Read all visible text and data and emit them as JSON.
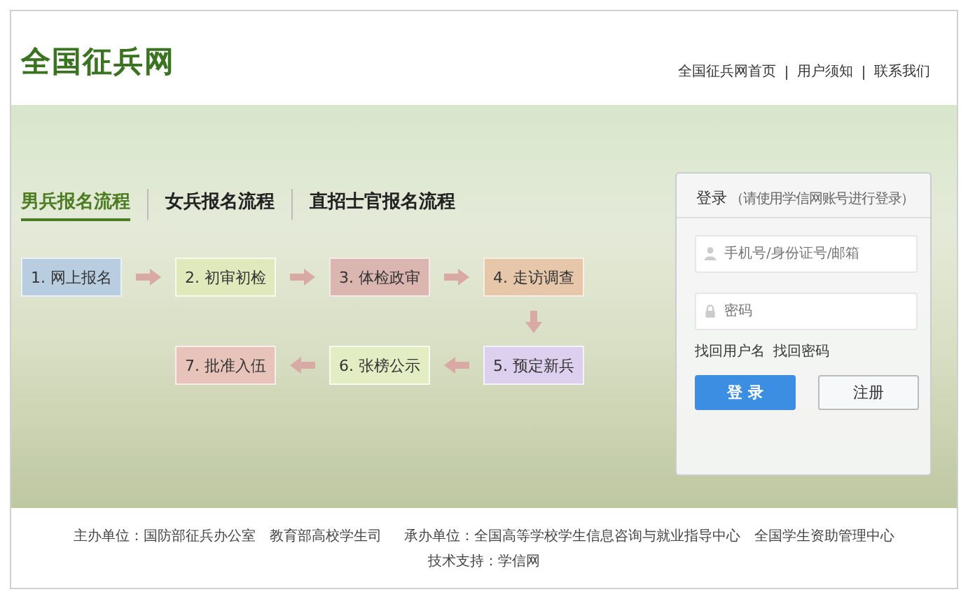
{
  "header": {
    "logo": "全国征兵网",
    "nav": [
      "全国征兵网首页",
      "用户须知",
      "联系我们"
    ]
  },
  "banner": {
    "tabs": [
      {
        "label": "男兵报名流程",
        "selected": true
      },
      {
        "label": "女兵报名流程",
        "selected": false
      },
      {
        "label": "直招士官报名流程",
        "selected": false
      }
    ],
    "step_rows": [
      [
        {
          "label": "1. 网上报名",
          "color": "#b9cde0"
        },
        {
          "label": "2. 初审初检",
          "color": "#e0e9bc"
        },
        {
          "label": "3. 体检政审",
          "color": "#dbb5b0"
        },
        {
          "label": "4. 走访调查",
          "color": "#e6c7aa"
        }
      ],
      [
        {
          "label": "7. 批准入伍",
          "color": "#e8c3ba"
        },
        {
          "label": "6. 张榜公示",
          "color": "#e3edc4"
        },
        {
          "label": "5. 预定新兵",
          "color": "#ddcfee"
        }
      ]
    ],
    "login": {
      "title": "登录",
      "note": "（请使用学信网账号进行登录）",
      "username_placeholder": "手机号/身份证号/邮箱",
      "password_placeholder": "密码",
      "links": [
        "找回用户名",
        "找回密码"
      ],
      "login_button": "登 录",
      "register_button": "注册"
    }
  },
  "footer": {
    "items": [
      "主办单位：国防部征兵办公室　教育部高校学生司",
      "承办单位：全国高等学校学生信息咨询与就业指导中心　全国学生资助管理中心",
      "技术支持：学信网"
    ]
  }
}
